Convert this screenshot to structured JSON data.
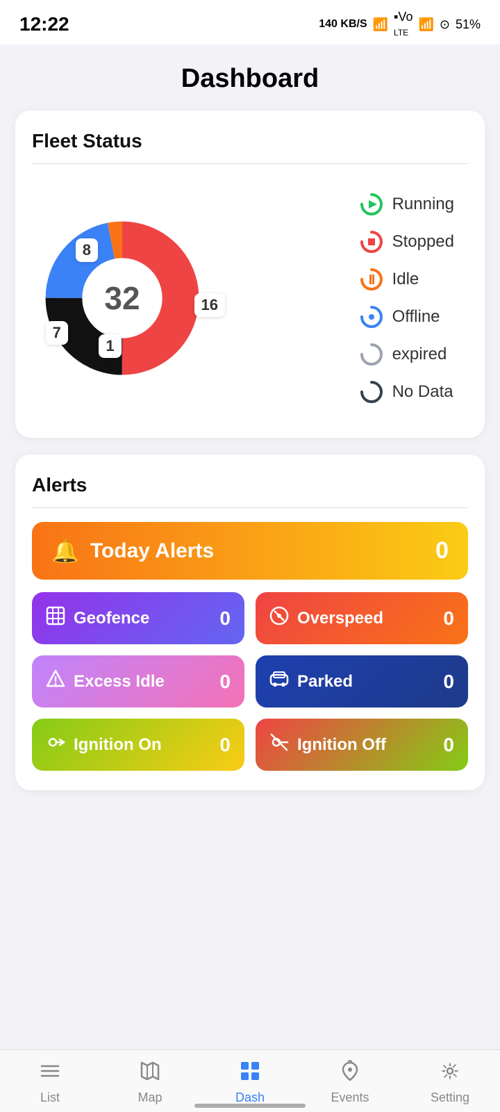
{
  "statusBar": {
    "time": "12:22",
    "network": "140 KB/S",
    "battery": "51%"
  },
  "pageTitle": "Dashboard",
  "fleetStatus": {
    "title": "Fleet Status",
    "total": "32",
    "segments": {
      "red": {
        "value": 16,
        "label": "16",
        "percent": 50
      },
      "black": {
        "value": 8,
        "label": "8",
        "percent": 25
      },
      "blue": {
        "value": 7,
        "label": "7",
        "percent": 21.875
      },
      "orange": {
        "value": 1,
        "label": "1",
        "percent": 3.125
      }
    },
    "legend": [
      {
        "label": "Running",
        "color": "#22c55e"
      },
      {
        "label": "Stopped",
        "color": "#ef4444"
      },
      {
        "label": "Idle",
        "color": "#f97316"
      },
      {
        "label": "Offline",
        "color": "#3b82f6"
      },
      {
        "label": "expired",
        "color": "#9ca3af"
      },
      {
        "label": "No Data",
        "color": "#374151"
      }
    ]
  },
  "alerts": {
    "title": "Alerts",
    "todayAlerts": {
      "label": "Today Alerts",
      "count": "0"
    },
    "buttons": [
      {
        "id": "geofence",
        "icon": "⊞",
        "label": "Geofence",
        "count": "0",
        "class": "btn-geofence"
      },
      {
        "id": "overspeed",
        "icon": "⊘",
        "label": "Overspeed",
        "count": "0",
        "class": "btn-overspeed"
      },
      {
        "id": "excessidle",
        "icon": "🔔",
        "label": "Excess Idle",
        "count": "0",
        "class": "btn-excessidle"
      },
      {
        "id": "parked",
        "icon": "🚌",
        "label": "Parked",
        "count": "0",
        "class": "btn-parked"
      },
      {
        "id": "ignitionon",
        "icon": "🔑",
        "label": "Ignition On",
        "count": "0",
        "class": "btn-ignitionon"
      },
      {
        "id": "ignitionoff",
        "icon": "🔕",
        "label": "Ignition Off",
        "count": "0",
        "class": "btn-ignitionoff"
      }
    ]
  },
  "bottomNav": {
    "items": [
      {
        "id": "list",
        "icon": "≡",
        "label": "List",
        "active": false
      },
      {
        "id": "map",
        "icon": "🗺",
        "label": "Map",
        "active": false
      },
      {
        "id": "dash",
        "icon": "⊞",
        "label": "Dash",
        "active": true
      },
      {
        "id": "events",
        "icon": "🔔",
        "label": "Events",
        "active": false
      },
      {
        "id": "setting",
        "icon": "⚙",
        "label": "Setting",
        "active": false
      }
    ]
  }
}
